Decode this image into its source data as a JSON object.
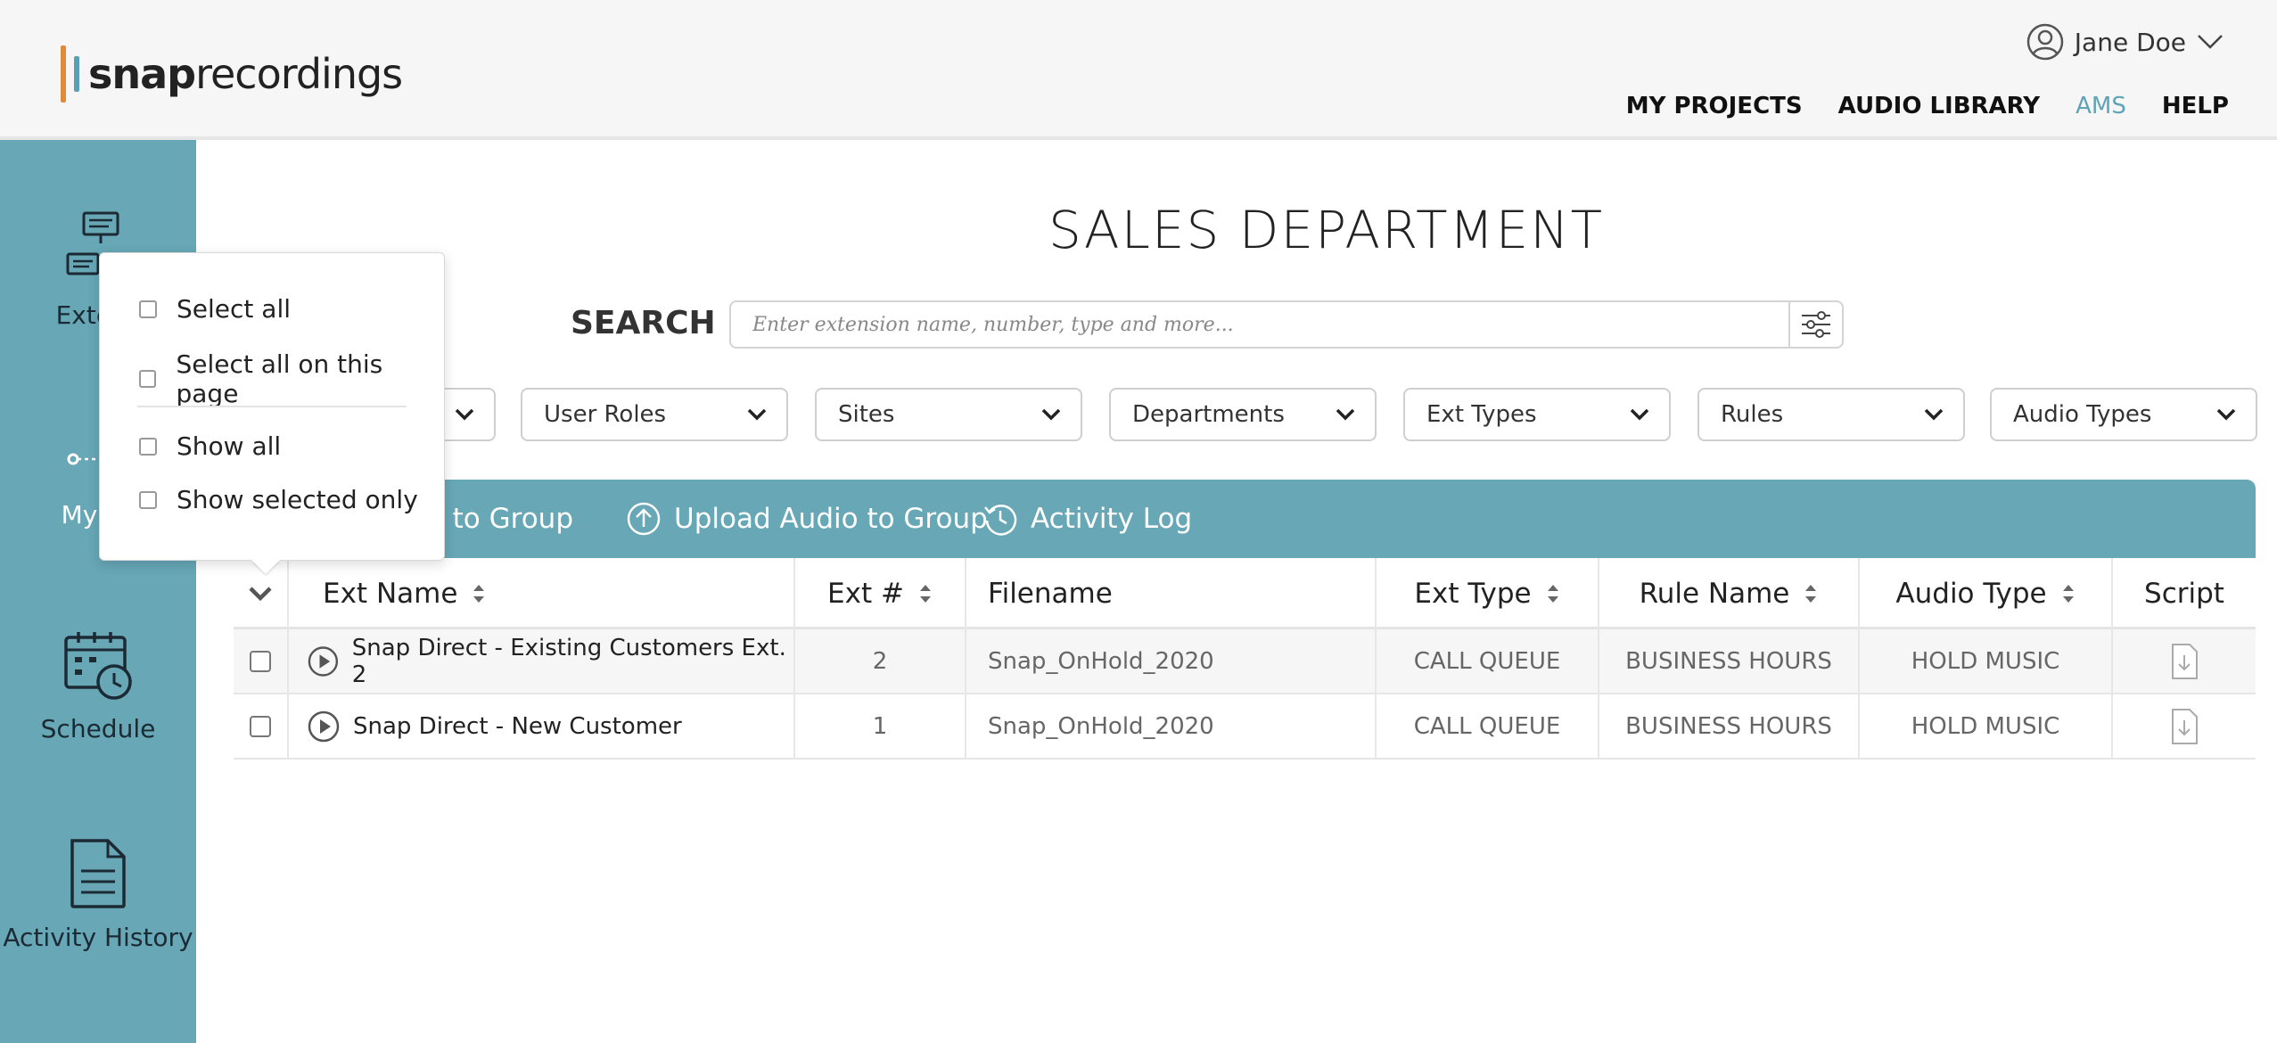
{
  "header": {
    "logo_bold": "snap",
    "logo_regular": "recordings",
    "user_name": "Jane Doe",
    "nav": [
      "MY PROJECTS",
      "AUDIO LIBRARY",
      "AMS",
      "HELP"
    ],
    "active_nav": "AMS"
  },
  "sidebar": {
    "items": [
      {
        "label": "Extens",
        "icon": "extensions-icon"
      },
      {
        "label": "My Gr",
        "icon": "my-groups-icon"
      },
      {
        "label": "Schedule",
        "icon": "schedule-icon"
      },
      {
        "label": "Activity History",
        "icon": "activity-history-icon"
      }
    ]
  },
  "page": {
    "title": "SALES DEPARTMENT",
    "search_label": "SEARCH",
    "search_placeholder": "Enter extension name, number, type and more..."
  },
  "filters": [
    "User Roles",
    "Sites",
    "Departments",
    "Ext Types",
    "Rules",
    "Audio Types"
  ],
  "toolbar": {
    "assign_label": "ns to Group",
    "upload_label": "Upload Audio to Group",
    "activity_label": "Activity Log"
  },
  "table": {
    "columns": [
      "Ext Name",
      "Ext #",
      "Filename",
      "Ext Type",
      "Rule Name",
      "Audio Type",
      "Script"
    ],
    "rows": [
      {
        "name": "Snap Direct - Existing Customers Ext. 2",
        "ext": "2",
        "filename": "Snap_OnHold_2020",
        "type": "CALL QUEUE",
        "rule": "BUSINESS HOURS",
        "audio": "HOLD MUSIC"
      },
      {
        "name": "Snap Direct - New Customer",
        "ext": "1",
        "filename": "Snap_OnHold_2020",
        "type": "CALL QUEUE",
        "rule": "BUSINESS HOURS",
        "audio": "HOLD MUSIC"
      }
    ]
  },
  "popover": {
    "options": [
      "Select all",
      "Select all on this page",
      "Show all",
      "Show selected only"
    ]
  },
  "colors": {
    "brand_teal": "#67a7b6",
    "accent_orange": "#e08a3c",
    "active_nav": "#5fa3b6"
  }
}
